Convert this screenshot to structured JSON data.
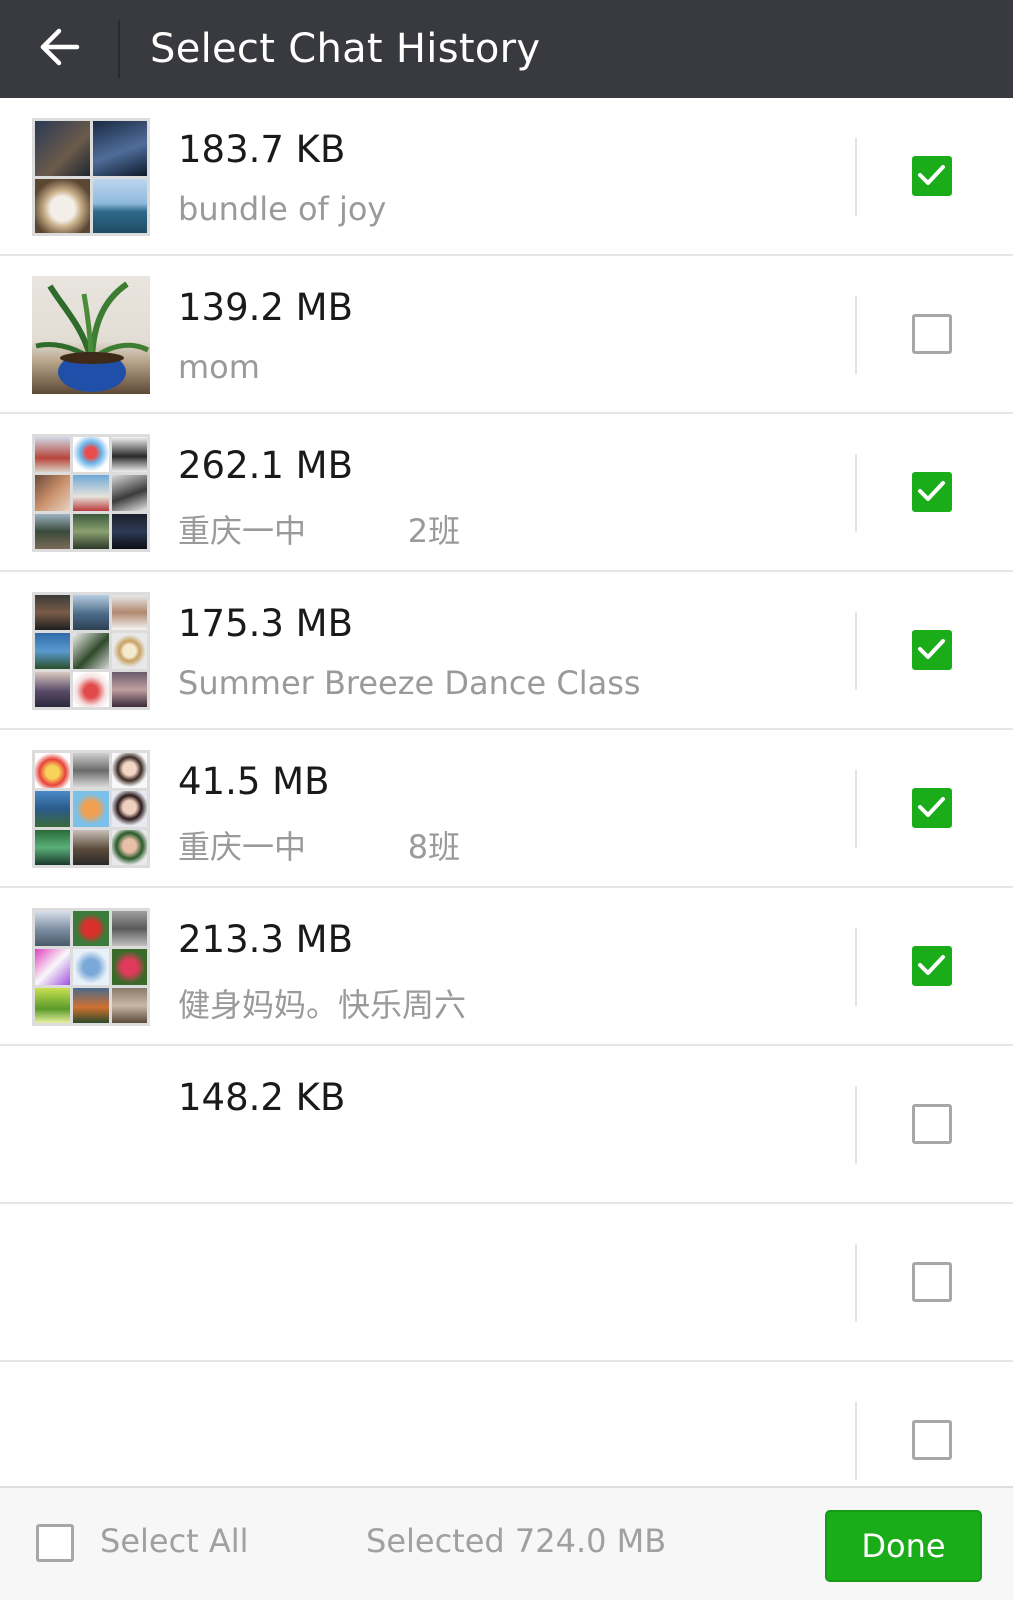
{
  "header": {
    "title": "Select Chat History",
    "back_icon": "arrow-left-icon"
  },
  "colors": {
    "header_bg": "#393a3f",
    "accent_green": "#1aad19",
    "secondary_text": "#9a9a9a"
  },
  "chats": [
    {
      "size": "183.7 KB",
      "name": "bundle of joy",
      "checked": true
    },
    {
      "size": "139.2 MB",
      "name": "mom",
      "checked": false
    },
    {
      "size": "262.1 MB",
      "name": "重庆一中          2班",
      "checked": true
    },
    {
      "size": "175.3 MB",
      "name": "Summer Breeze Dance Class",
      "checked": true
    },
    {
      "size": "41.5 MB",
      "name": "重庆一中          8班",
      "checked": true
    },
    {
      "size": "213.3 MB",
      "name": "健身妈妈。快乐周六",
      "checked": true
    },
    {
      "size": "148.2 KB",
      "name": "",
      "checked": false
    },
    {
      "size": "",
      "name": "",
      "checked": false
    },
    {
      "size": "",
      "name": "",
      "checked": false
    }
  ],
  "footer": {
    "select_all_label": "Select All",
    "selected_info": "Selected 724.0 MB",
    "done_label": "Done"
  }
}
